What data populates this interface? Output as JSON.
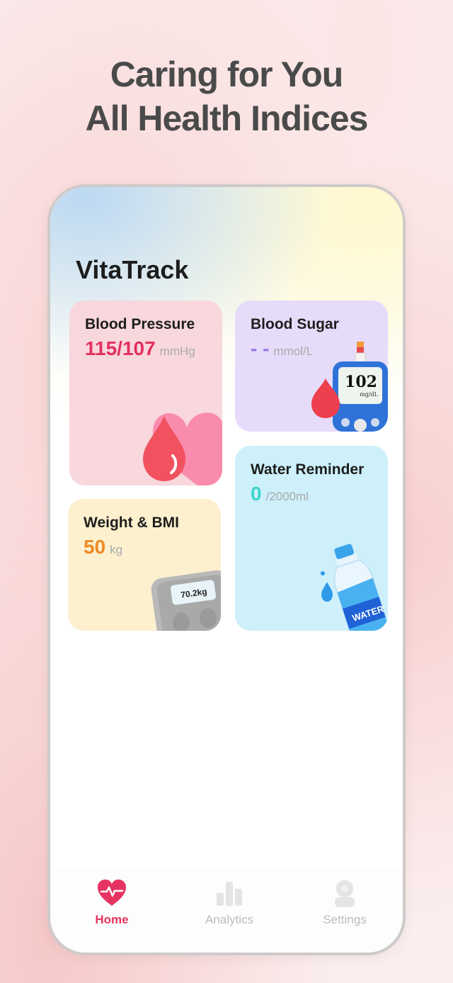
{
  "headline": {
    "line1": "Caring for You",
    "line2": "All Health Indices"
  },
  "app": {
    "title": "VitaTrack"
  },
  "cards": {
    "blood_pressure": {
      "label": "Blood Pressure",
      "value": "115/107",
      "unit": "mmHg",
      "value_color": "#e2315e",
      "icon": "blood-drop-heart-icon"
    },
    "blood_sugar": {
      "label": "Blood Sugar",
      "value": "- -",
      "unit": "mmol/L",
      "value_color": "#9a73e8",
      "icon": "glucose-meter-icon",
      "meter_reading": "102",
      "meter_unit": "mg/dL"
    },
    "weight": {
      "label": "Weight & BMI",
      "value": "50",
      "unit": "kg",
      "value_color": "#f08a24",
      "icon": "scale-icon",
      "scale_reading": "70.2kg"
    },
    "water": {
      "label": "Water Reminder",
      "value": "0",
      "unit": "/2000ml",
      "value_color": "#3fd3c8",
      "icon": "water-bottle-icon",
      "bottle_label": "WATER"
    }
  },
  "tabs": [
    {
      "label": "Home",
      "icon": "heart-pulse-icon",
      "active": true
    },
    {
      "label": "Analytics",
      "icon": "bar-chart-icon",
      "active": false
    },
    {
      "label": "Settings",
      "icon": "user-icon",
      "active": false
    }
  ],
  "colors": {
    "accent": "#e63462",
    "inactive": "#bdbdbd"
  }
}
